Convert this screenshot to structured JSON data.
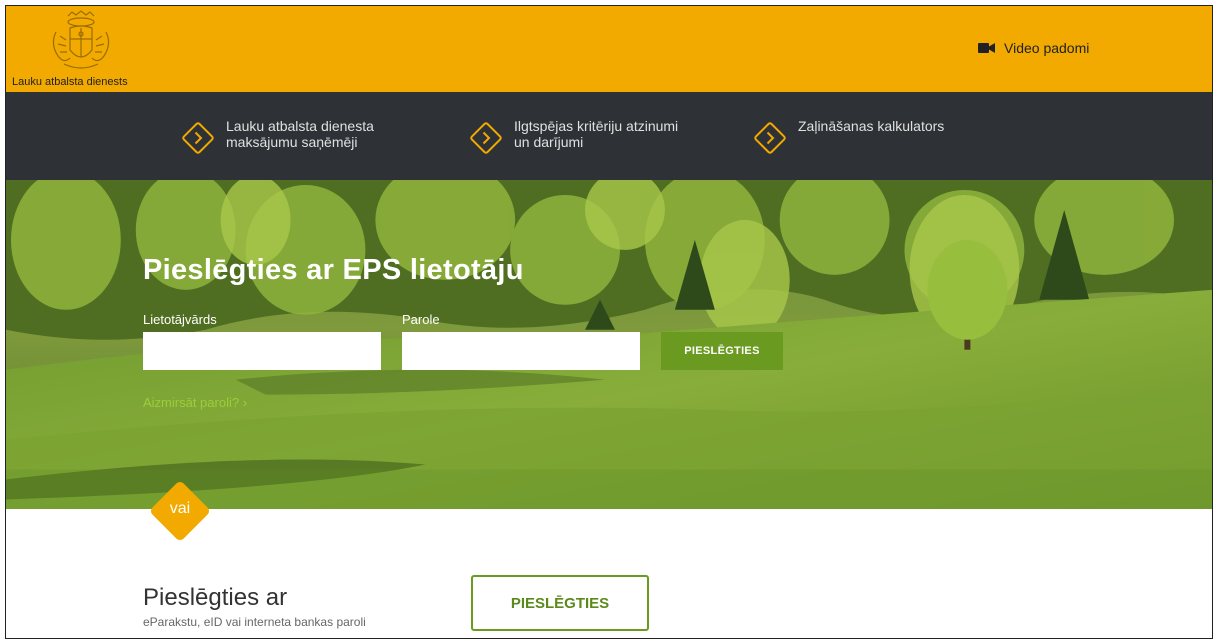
{
  "header": {
    "org_name": "Lauku atbalsta dienests",
    "video_link": "Video padomi"
  },
  "nav": {
    "items": [
      {
        "label": "Lauku atbalsta dienesta maksājumu saņēmēji"
      },
      {
        "label": "Ilgtspējas kritēriju atzinumi un darījumi"
      },
      {
        "label": "Zaļināšanas kalkulators"
      }
    ]
  },
  "login": {
    "title": "Pieslēgties ar EPS lietotāju",
    "username_label": "Lietotājvārds",
    "username_value": "",
    "password_label": "Parole",
    "password_value": "",
    "submit_label": "PIESLĒGTIES",
    "forgot_label": "Aizmirsāt paroli? ›"
  },
  "divider": {
    "label": "vai"
  },
  "alt_login": {
    "title": "Pieslēgties ar",
    "subtitle": "eParakstu, eID vai interneta bankas paroli",
    "button_label": "PIESLĒGTIES"
  },
  "colors": {
    "brand_orange": "#f2a900",
    "nav_dark": "#2e3135",
    "accent_green": "#6a9a1f",
    "link_green": "#9ccd3a"
  },
  "icons": {
    "logo": "coat-of-arms-icon",
    "video": "video-camera-icon",
    "nav_arrow": "chevron-diamond-icon"
  }
}
